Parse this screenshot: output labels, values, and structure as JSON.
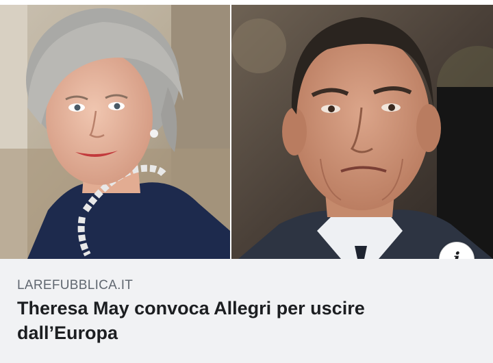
{
  "post": {
    "photos": [
      {
        "subject": "left-portrait"
      },
      {
        "subject": "right-portrait"
      }
    ],
    "info_icon": {
      "name": "info-icon",
      "glyph": "i"
    },
    "source": "LAREFUBBLICA.IT",
    "headline_lines": [
      "Theresa May convoca Allegri per uscire",
      "dall’Europa"
    ],
    "colors": {
      "caption_bg": "#f1f2f4",
      "source_text": "#606770",
      "headline_text": "#1c1e21"
    }
  }
}
